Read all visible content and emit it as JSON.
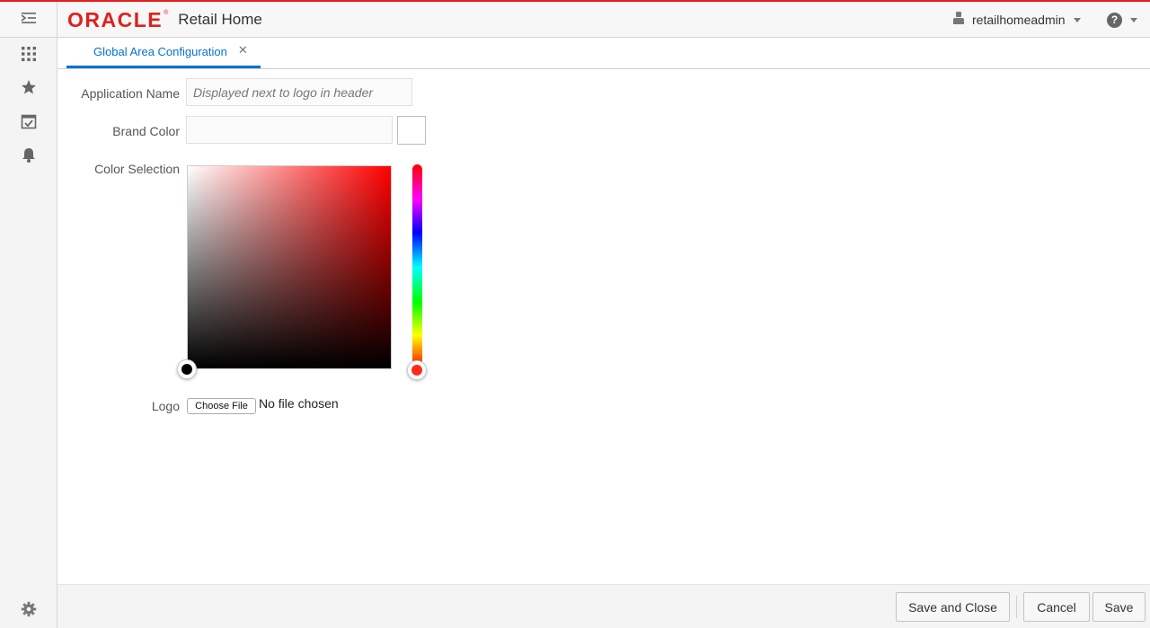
{
  "header": {
    "logo_text": "ORACLE",
    "logo_mark": "®",
    "app_title": "Retail Home",
    "user_name": "retailhomeadmin",
    "help_glyph": "?",
    "brand_color": "#e0201c"
  },
  "tabs": [
    {
      "label": "Global Area Configuration",
      "close_glyph": "✕"
    }
  ],
  "form": {
    "app_name_label": "Application Name",
    "app_name_placeholder": "Displayed next to logo in header",
    "app_name_value": "",
    "brand_color_label": "Brand Color",
    "brand_color_value": "",
    "color_selection_label": "Color Selection",
    "selected_hue": "#ff0000",
    "logo_label": "Logo",
    "choose_file_label": "Choose File",
    "file_status": "No file chosen"
  },
  "sidebar": {
    "icons": [
      "navigator-icon",
      "apps-grid-icon",
      "favorites-star-icon",
      "tasks-calendar-icon",
      "notifications-bell-icon",
      "settings-gear-icon"
    ]
  },
  "footer": {
    "save_close_label": "Save and Close",
    "cancel_label": "Cancel",
    "save_label": "Save"
  },
  "colors": {
    "accent": "#0572ce",
    "oracle_red": "#e0201c"
  }
}
